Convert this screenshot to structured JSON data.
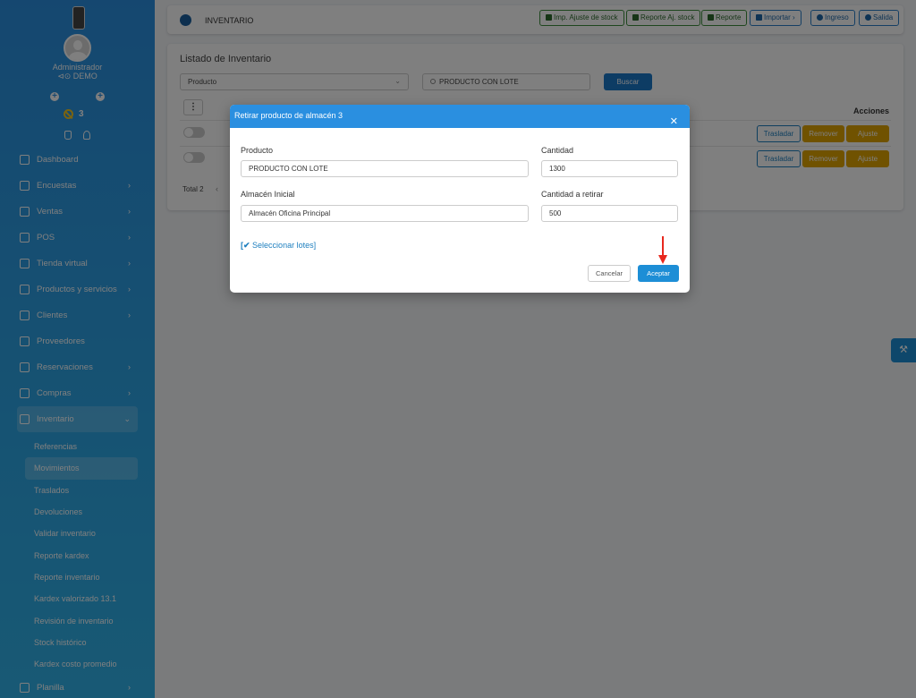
{
  "sidebar": {
    "user": "Administrador",
    "company": "⊲⊙ DEMO",
    "notif_count": "3",
    "nav": [
      {
        "label": "Dashboard",
        "icon": "dashboard-icon"
      },
      {
        "label": "Encuestas",
        "icon": "document-icon"
      },
      {
        "label": "Ventas",
        "icon": "document-icon"
      },
      {
        "label": "POS",
        "icon": "cart-icon"
      },
      {
        "label": "Tienda virtual",
        "icon": "store-icon"
      },
      {
        "label": "Productos y servicios",
        "icon": "boxes-icon"
      },
      {
        "label": "Clientes",
        "icon": "boxes-icon"
      },
      {
        "label": "Proveedores",
        "icon": "user-icon"
      },
      {
        "label": "Reservaciones",
        "icon": "quote-icon"
      },
      {
        "label": "Compras",
        "icon": "briefcase-icon"
      },
      {
        "label": "Inventario",
        "icon": "book-icon"
      }
    ],
    "sub": [
      "Referencias",
      "Movimientos",
      "Traslados",
      "Devoluciones",
      "Validar inventario",
      "Reporte kardex",
      "Reporte inventario",
      "Kardex valorizado 13.1",
      "Revisión de inventario",
      "Stock histórico",
      "Kardex costo promedio"
    ],
    "last_item": "Planilla"
  },
  "topbar": {
    "title": "INVENTARIO",
    "buttons": [
      "Imp. Ajuste de stock",
      "Reporte Aj. stock",
      "Reporte",
      "Importar",
      "Ingreso",
      "Salida"
    ]
  },
  "listing": {
    "title": "Listado de Inventario",
    "filter_select": "Producto",
    "search_value": "PRODUCTO CON LOTE",
    "search_button": "Buscar",
    "actions_header": "Acciones",
    "row_buttons": {
      "transfer": "Trasladar",
      "remove": "Remover",
      "adjust": "Ajuste"
    },
    "total": "Total 2"
  },
  "modal": {
    "title": "Retirar producto de almacén 3",
    "product_label": "Producto",
    "product_value": "PRODUCTO CON LOTE",
    "quantity_label": "Cantidad",
    "quantity_value": "1300",
    "warehouse_label": "Almacén Inicial",
    "warehouse_value": "Almacén Oficina Principal",
    "withdraw_label": "Cantidad a retirar",
    "withdraw_value": "500",
    "lots_link": "Seleccionar lotes]",
    "lots_prefix": "[✔ ",
    "cancel": "Cancelar",
    "accept": "Aceptar"
  },
  "colors": {
    "sidebar": "#2a8fe0",
    "primary": "#1d8ed6",
    "warning": "#e0a400",
    "arrow": "#e8281e"
  }
}
